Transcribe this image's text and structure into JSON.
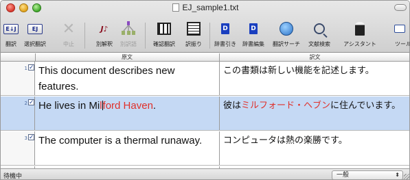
{
  "window": {
    "title": "EJ_sample1.txt"
  },
  "toolbar": {
    "items": [
      {
        "label": "翻訳",
        "glyph": "E↓J",
        "disabled": false
      },
      {
        "label": "選択翻訳",
        "glyph": "EJ",
        "disabled": false
      },
      {
        "label": "中止",
        "glyph": "✕",
        "disabled": true
      },
      {
        "label": "別解釈",
        "glyph": "J♪",
        "disabled": false
      },
      {
        "label": "別訳語",
        "glyph": "",
        "disabled": true
      },
      {
        "label": "確認翻訳",
        "glyph": "",
        "disabled": false
      },
      {
        "label": "訳振り",
        "glyph": "",
        "disabled": false
      },
      {
        "label": "辞書引き",
        "glyph": "D",
        "disabled": false
      },
      {
        "label": "辞書編集",
        "glyph": "D",
        "disabled": false
      },
      {
        "label": "翻訳サーチ",
        "glyph": "",
        "disabled": false
      },
      {
        "label": "文献検索",
        "glyph": "",
        "disabled": false
      },
      {
        "label": "アシスタント",
        "glyph": "",
        "disabled": false
      },
      {
        "label": "ツール",
        "glyph": "",
        "disabled": false
      }
    ]
  },
  "columns": {
    "source": "原文",
    "target": "訳文"
  },
  "rows": [
    {
      "num": "1",
      "checked": "✓",
      "source": "This document describes new features.",
      "target": "この書類は新しい機能を記述します。"
    },
    {
      "num": "2",
      "checked": "✓",
      "source_pre": "He lives in Mi",
      "source_red_a": "l",
      "source_red_b": "ford Haven",
      "source_post": ".",
      "target_pre": "彼は",
      "target_red": "ミルフォード・ヘブン",
      "target_post": "に住んでいます。"
    },
    {
      "num": "3",
      "checked": "✓",
      "source": "The computer is a thermal runaway.",
      "target": "コンピュータは熱の楽勝です。"
    }
  ],
  "status": {
    "text": "待機中",
    "mode": "一般",
    "mode_arrow": "⬍"
  },
  "colors": {
    "selected_row": "#c5d9f4",
    "highlight": "#e0302a"
  }
}
